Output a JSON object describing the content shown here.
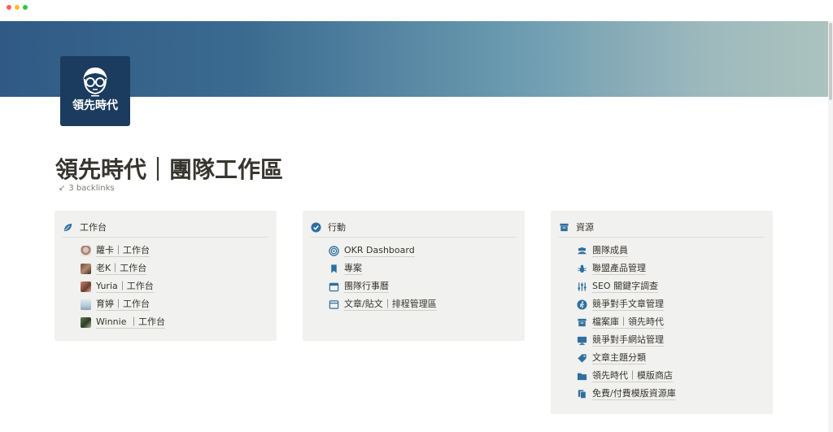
{
  "page": {
    "title": "領先時代｜團隊工作區",
    "backlinks": "3 backlinks",
    "logo_text": "領先時代"
  },
  "window": {
    "traffic_lights": [
      "#ff5f57",
      "#febc2e",
      "#28c840"
    ]
  },
  "colors": {
    "accent_blue": "#2f6f9f",
    "callout_bg": "#f1f1ef",
    "logo_bg": "#1b3c5e"
  },
  "workbench": {
    "title": "工作台",
    "icon": "leaf-icon",
    "items": [
      {
        "label": "蘿卡｜工作台",
        "avatar": "avatar-rocca"
      },
      {
        "label": "老K｜工作台",
        "avatar": "avatar-old-k"
      },
      {
        "label": "Yuria｜工作台",
        "avatar": "avatar-yuria"
      },
      {
        "label": "育婷｜工作台",
        "avatar": "avatar-yu-ting"
      },
      {
        "label": "Winnie ｜工作台",
        "avatar": "avatar-winnie"
      }
    ]
  },
  "actions": {
    "title": "行動",
    "icon": "check-circle-icon",
    "items": [
      {
        "label": "OKR Dashboard",
        "icon": "target-icon"
      },
      {
        "label": "專案",
        "icon": "bookmark-icon"
      },
      {
        "label": "團隊行事曆",
        "icon": "calendar-icon"
      },
      {
        "label": "文章/貼文｜排程管理區",
        "icon": "browser-window-icon"
      }
    ]
  },
  "resources": {
    "title": "資源",
    "icon": "archive-icon",
    "items": [
      {
        "label": "團隊成員",
        "icon": "people-icon"
      },
      {
        "label": "聯盟產品管理",
        "icon": "bug-icon"
      },
      {
        "label": "SEO 關鍵字調查",
        "icon": "sliders-icon"
      },
      {
        "label": "競爭對手文章管理",
        "icon": "runner-icon"
      },
      {
        "label": "檔案庫｜領先時代",
        "icon": "archive-icon"
      },
      {
        "label": "競爭對手網站管理",
        "icon": "monitor-icon"
      },
      {
        "label": "文章主題分類",
        "icon": "tag-icon"
      },
      {
        "label": "領先時代｜模版商店",
        "icon": "folder-icon"
      },
      {
        "label": "免費/付費模版資源庫",
        "icon": "documents-icon"
      }
    ]
  }
}
